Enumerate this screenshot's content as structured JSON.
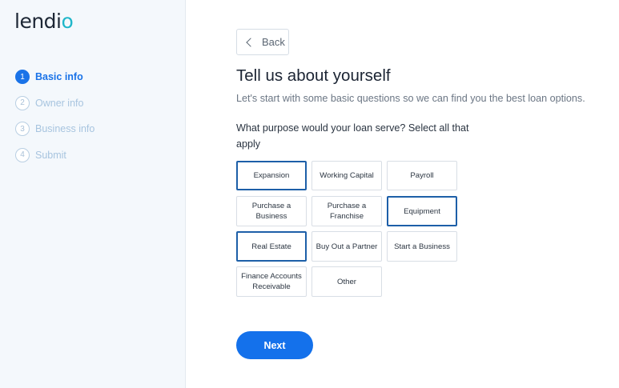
{
  "brand": {
    "logo_text": "lendi",
    "logo_accent": "o"
  },
  "sidebar": {
    "steps": [
      {
        "num": "1",
        "label": "Basic info",
        "active": true
      },
      {
        "num": "2",
        "label": "Owner info",
        "active": false
      },
      {
        "num": "3",
        "label": "Business info",
        "active": false
      },
      {
        "num": "4",
        "label": "Submit",
        "active": false
      }
    ]
  },
  "main": {
    "back_label": "Back",
    "title": "Tell us about yourself",
    "subtitle": "Let's start with some basic questions so we can find you the best loan options.",
    "question": "What purpose would your loan serve? Select all that apply",
    "options": [
      {
        "label": "Expansion",
        "selected": true
      },
      {
        "label": "Working Capital",
        "selected": false
      },
      {
        "label": "Payroll",
        "selected": false
      },
      {
        "label": "Purchase a Business",
        "selected": false
      },
      {
        "label": "Purchase a Franchise",
        "selected": false
      },
      {
        "label": "Equipment",
        "selected": true
      },
      {
        "label": "Real Estate",
        "selected": true
      },
      {
        "label": "Buy Out a Partner",
        "selected": false
      },
      {
        "label": "Start a Business",
        "selected": false
      },
      {
        "label": "Finance Accounts Receivable",
        "selected": false
      },
      {
        "label": "Other",
        "selected": false
      }
    ],
    "next_label": "Next"
  },
  "colors": {
    "accent": "#1a73e8",
    "selected_border": "#1d5fa8",
    "logo_accent": "#1fb6c9",
    "sidebar_bg": "#f4f8fc"
  }
}
